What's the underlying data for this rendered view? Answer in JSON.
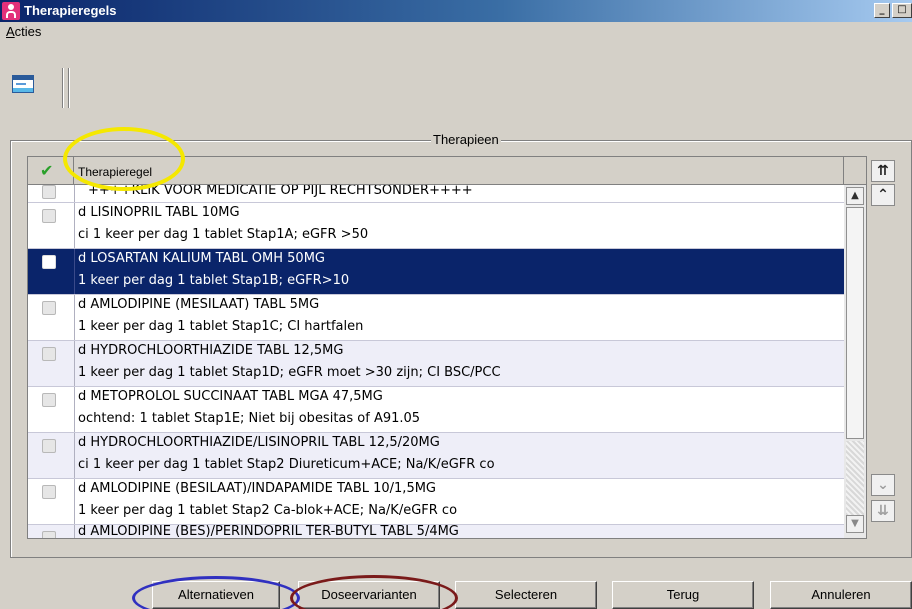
{
  "window": {
    "title": "Therapieregels"
  },
  "menu": {
    "items": [
      {
        "label_underlined": "A",
        "label_rest": "cties"
      }
    ]
  },
  "group": {
    "title": "Therapieen"
  },
  "grid": {
    "header": {
      "column": "Therapieregel"
    },
    "rows": [
      {
        "line1": "++++KLIK VOOR MEDICATIE OP PIJL RECHTSONDER++++",
        "line2": ""
      },
      {
        "line1": "d LISINOPRIL TABL 10MG",
        "line2": "ci 1 keer per dag 1 tablet Stap1A; eGFR >50"
      },
      {
        "line1": "d LOSARTAN KALIUM TABL OMH 50MG",
        "line2": "1 keer per dag 1 tablet Stap1B; eGFR>10"
      },
      {
        "line1": "d AMLODIPINE (MESILAAT) TABL 5MG",
        "line2": "1 keer per dag 1 tablet Stap1C; CI hartfalen"
      },
      {
        "line1": "d HYDROCHLOORTHIAZIDE TABL 12,5MG",
        "line2": "1 keer per dag 1 tablet Stap1D; eGFR moet >30 zijn; CI BSC/PCC"
      },
      {
        "line1": "d METOPROLOL SUCCINAAT TABL MGA 47,5MG",
        "line2": "ochtend: 1 tablet Stap1E; Niet bij obesitas of A91.05"
      },
      {
        "line1": "d HYDROCHLOORTHIAZIDE/LISINOPRIL TABL 12,5/20MG",
        "line2": "ci 1 keer per dag 1 tablet Stap2 Diureticum+ACE; Na/K/eGFR co"
      },
      {
        "line1": "d AMLODIPINE (BESILAAT)/INDAPAMIDE TABL 10/1,5MG",
        "line2": "1 keer per dag 1 tablet Stap2 Ca-blok+ACE; Na/K/eGFR co"
      },
      {
        "line1": "d AMLODIPINE (BES)/PERINDOPRIL TER-BUTYL TABL 5/4MG",
        "line2": ""
      }
    ],
    "selected_row": 2
  },
  "buttons": {
    "alternatieven": "Alternatieven",
    "doseervarianten": "Doseervarianten",
    "selecteren": "Selecteren",
    "terug": "Terug",
    "annuleren": "Annuleren"
  },
  "annotations": {
    "header_highlight_color": "#f5e800",
    "alternatieven_ring_color": "#3030c0",
    "doseervarianten_ring_color": "#7a1a1a"
  },
  "icons": [
    "user-app-icon",
    "minimize-icon",
    "maximize-icon",
    "checkmark-icon",
    "list-view-icon",
    "scroll-up-icon",
    "scroll-down-icon",
    "jump-top-icon",
    "page-up-icon",
    "page-down-icon",
    "jump-bottom-icon"
  ]
}
